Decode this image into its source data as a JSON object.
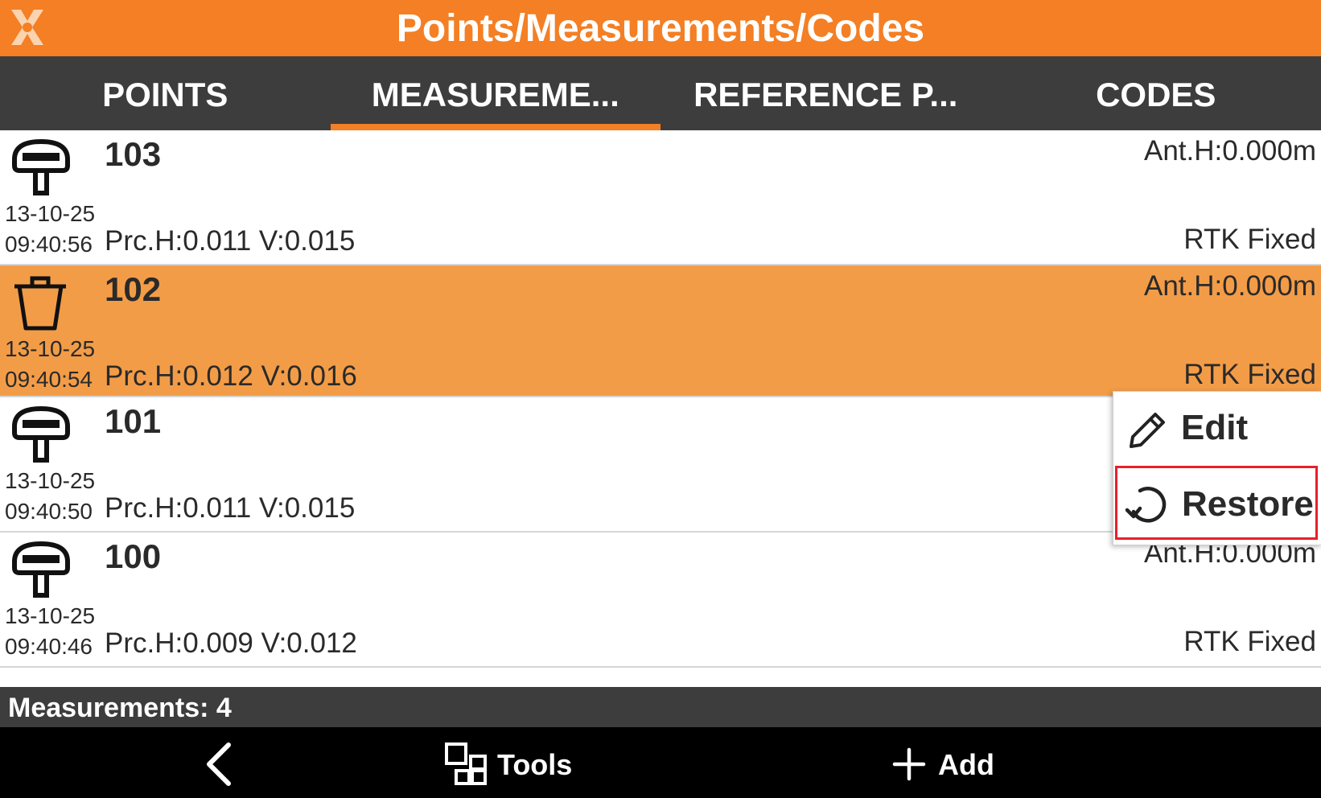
{
  "app": {
    "title": "Points/Measurements/Codes",
    "accent_color": "#f47f24",
    "logo_icon": "app-logo-x-icon"
  },
  "tabs": [
    {
      "label": "POINTS",
      "active": false
    },
    {
      "label": "MEASUREME...",
      "active": true
    },
    {
      "label": "REFERENCE P...",
      "active": false
    },
    {
      "label": "CODES",
      "active": false
    }
  ],
  "measurements": [
    {
      "name": "103",
      "date": "13-10-25",
      "time": "09:40:56",
      "precision": "Prc.H:0.011 V:0.015",
      "antenna": "Ant.H:0.000m",
      "status": "RTK Fixed",
      "icon": "gnss-receiver-icon",
      "deleted": false
    },
    {
      "name": "102",
      "date": "13-10-25",
      "time": "09:40:54",
      "precision": "Prc.H:0.012 V:0.016",
      "antenna": "Ant.H:0.000m",
      "status": "RTK Fixed",
      "icon": "trash-icon",
      "deleted": true
    },
    {
      "name": "101",
      "date": "13-10-25",
      "time": "09:40:50",
      "precision": "Prc.H:0.011 V:0.015",
      "antenna": "",
      "status": "",
      "icon": "gnss-receiver-icon",
      "deleted": false
    },
    {
      "name": "100",
      "date": "13-10-25",
      "time": "09:40:46",
      "precision": "Prc.H:0.009 V:0.012",
      "antenna": "Ant.H:0.000m",
      "status": "RTK Fixed",
      "icon": "gnss-receiver-icon",
      "deleted": false
    }
  ],
  "context_menu": {
    "items": [
      {
        "label": "Edit",
        "icon": "pencil-icon"
      },
      {
        "label": "Restore",
        "icon": "restore-icon",
        "highlight_color": "#e8202a"
      }
    ]
  },
  "footer": {
    "count_text": "Measurements: 4"
  },
  "navbar": {
    "back_icon": "chevron-left-icon",
    "tools_label": "Tools",
    "tools_icon": "tools-grid-icon",
    "add_label": "Add",
    "add_icon": "plus-icon"
  }
}
